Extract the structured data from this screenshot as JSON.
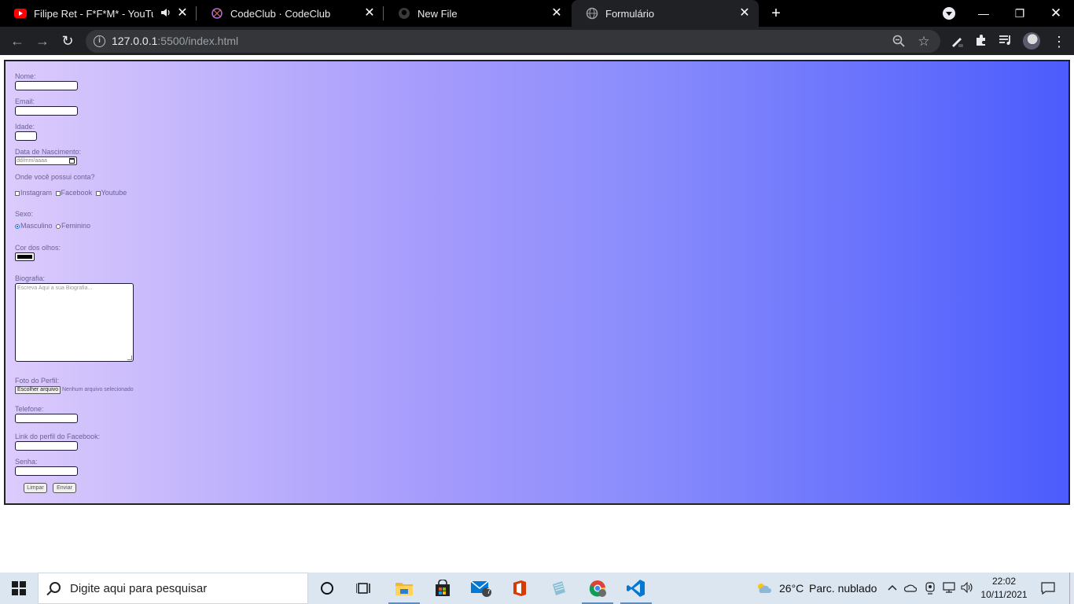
{
  "browser": {
    "tabs": [
      {
        "title": "Filipe Ret - F*F*M* - YouTube",
        "favicon": "youtube-icon",
        "audio": true
      },
      {
        "title": "CodeClub · CodeClub",
        "favicon": "codeclub-icon"
      },
      {
        "title": "New File",
        "favicon": "github-icon"
      },
      {
        "title": "Formulário",
        "favicon": "globe-icon",
        "active": true
      }
    ],
    "url_host": "127.0.0.1",
    "url_rest": ":5500/index.html"
  },
  "form": {
    "nome_label": "Nome:",
    "email_label": "Email:",
    "idade_label": "Idade:",
    "nascimento_label": "Data de Nascimento:",
    "nascimento_placeholder": "dd/mm/aaaa",
    "contas_label": "Onde você possui conta?",
    "contas": [
      "Instagram",
      "Facebook",
      "Youtube"
    ],
    "sexo_label": "Sexo:",
    "sexo_options": [
      "Masculino",
      "Feminino"
    ],
    "sexo_selected": "Masculino",
    "olhos_label": "Cor dos olhos:",
    "olhos_color": "#000000",
    "bio_label": "Biografia:",
    "bio_placeholder": "Escreva Aqui a sua Biografia...",
    "foto_label": "Foto do Perfil:",
    "foto_button": "Escolher arquivo",
    "foto_status": "Nenhum arquivo selecionado",
    "telefone_label": "Telefone:",
    "facebook_label": "Link do perfil do Facebook:",
    "senha_label": "Senha:",
    "limpar_button": "Limpar",
    "enviar_button": "Enviar"
  },
  "taskbar": {
    "search_placeholder": "Digite aqui para pesquisar",
    "weather_temp": "26°C",
    "weather_desc": "Parc. nublado",
    "time": "22:02",
    "date": "10/11/2021",
    "mail_badge": "7"
  },
  "colors": {
    "gradient_start": "#dccbfc",
    "gradient_end": "#4b5cfc",
    "vscode_blue": "#0078d4"
  }
}
